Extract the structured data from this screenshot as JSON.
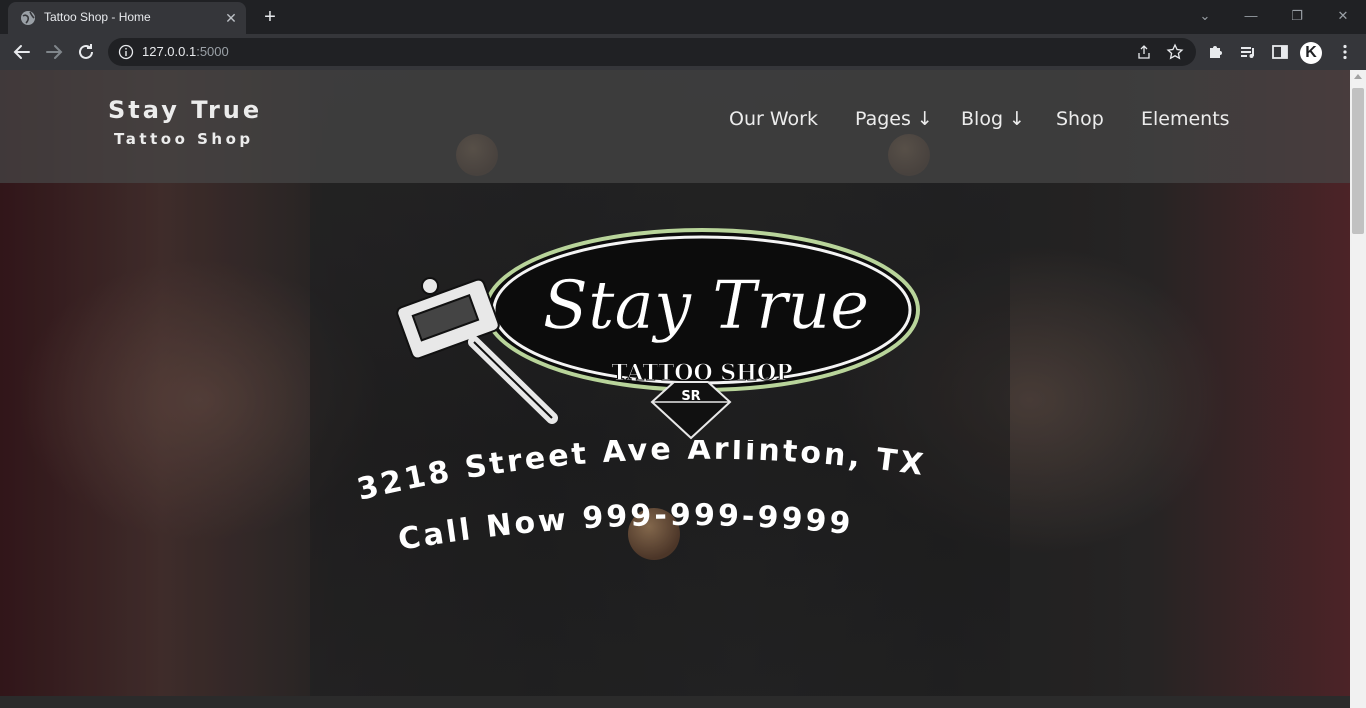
{
  "browser": {
    "tab_title": "Tattoo Shop - Home",
    "tab_close": "✕",
    "new_tab": "+",
    "url_host": "127.0.0.1",
    "url_port": ":5000",
    "profile_initial": "K",
    "window_buttons": {
      "dropdown": "⌄",
      "minimize": "—",
      "restore": "❐",
      "close": "✕"
    }
  },
  "site": {
    "brand_title": "Stay True",
    "brand_subtitle": "Tattoo Shop",
    "nav": [
      {
        "label": "Our Work"
      },
      {
        "label": "Pages ↓"
      },
      {
        "label": "Blog ↓"
      },
      {
        "label": "Shop"
      },
      {
        "label": "Elements"
      }
    ],
    "logo": {
      "script_text": "Stay True",
      "banner_text": "TATTOO SHOP",
      "monogram": "SR"
    },
    "address": "3218 Street Ave Arlinton, TX",
    "phone_line": "Call Now 999-999-9999"
  },
  "colors": {
    "header_overlay": "#464646",
    "nav_text": "#ececec",
    "logo_border": "#b8d49a"
  }
}
